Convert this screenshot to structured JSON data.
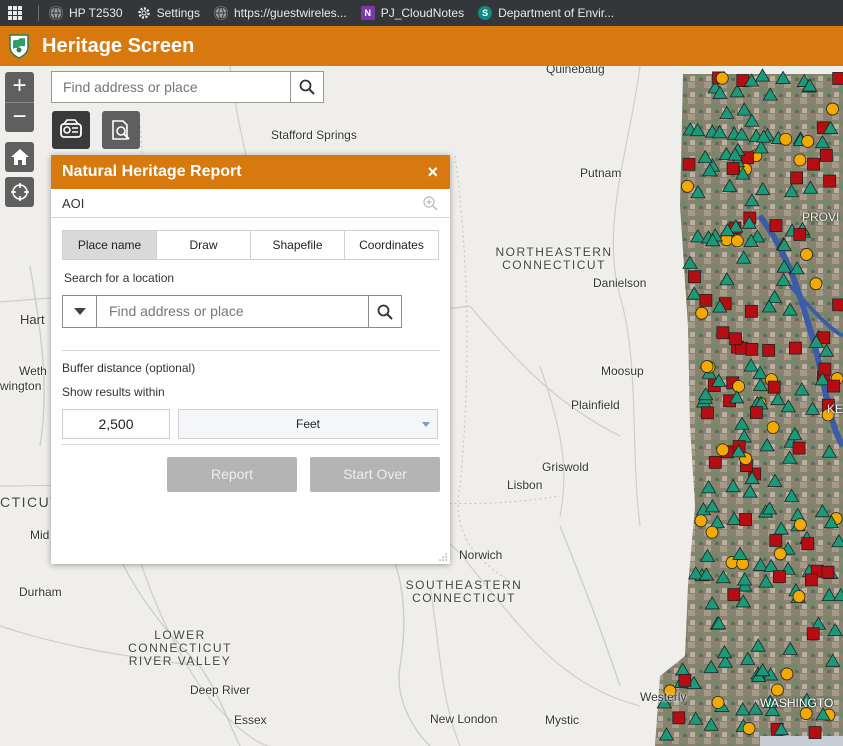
{
  "bookmarks": [
    {
      "icon": "globe-icon",
      "label": "HP T2530",
      "color": "#e8eaed"
    },
    {
      "icon": "gear-icon",
      "label": "Settings",
      "color": "#e8eaed"
    },
    {
      "icon": "globe-icon",
      "label": "https://guestwireles...",
      "color": "#e8eaed"
    },
    {
      "icon": "onenote-icon",
      "label": "PJ_CloudNotes",
      "color": "#7b3aa8"
    },
    {
      "icon": "sharepoint-icon",
      "label": "Department of Envir...",
      "color": "#138a8a"
    }
  ],
  "app": {
    "title": "Heritage Screen",
    "accent": "#d8790f"
  },
  "map": {
    "search_placeholder": "Find address or place",
    "zoom_in": "+",
    "zoom_out": "−",
    "places": [
      {
        "name": "Quinebaug"
      },
      {
        "name": "Stafford Springs"
      },
      {
        "name": "Putnam"
      },
      {
        "name": "Danielson"
      },
      {
        "name": "Moosup"
      },
      {
        "name": "Plainfield"
      },
      {
        "name": "Griswold"
      },
      {
        "name": "Lisbon"
      },
      {
        "name": "Norwich"
      },
      {
        "name": "Hart"
      },
      {
        "name": "Weth"
      },
      {
        "name": "wington"
      },
      {
        "name": "Mid"
      },
      {
        "name": "Durham"
      },
      {
        "name": "Deep River"
      },
      {
        "name": "Essex"
      },
      {
        "name": "New London"
      },
      {
        "name": "Mystic"
      },
      {
        "name": "Westerly"
      },
      {
        "name": "PROVI"
      },
      {
        "name": "KE"
      },
      {
        "name": "WASHINGTO"
      }
    ],
    "regions": [
      {
        "text": "NORTHEASTERN CONNECTICUT"
      },
      {
        "text": "SOUTHEASTERN CONNECTICUT"
      },
      {
        "text": "LOWER CONNECTICUT RIVER VALLEY"
      },
      {
        "text": "CTICUT"
      }
    ],
    "marker_colors": {
      "triangle": "#1a9a78",
      "square": "#b50d12",
      "circle": "#f2a900"
    }
  },
  "panel": {
    "title": "Natural Heritage Report",
    "close": "×",
    "aoi_label": "AOI",
    "tabs": [
      "Place name",
      "Draw",
      "Shapefile",
      "Coordinates"
    ],
    "search_label": "Search for a location",
    "search_placeholder": "Find address or place",
    "buffer_label": "Buffer distance (optional)",
    "show_within_label": "Show results within",
    "buffer_value": "2,500",
    "unit": "Feet",
    "report_button": "Report",
    "start_over_button": "Start Over"
  }
}
